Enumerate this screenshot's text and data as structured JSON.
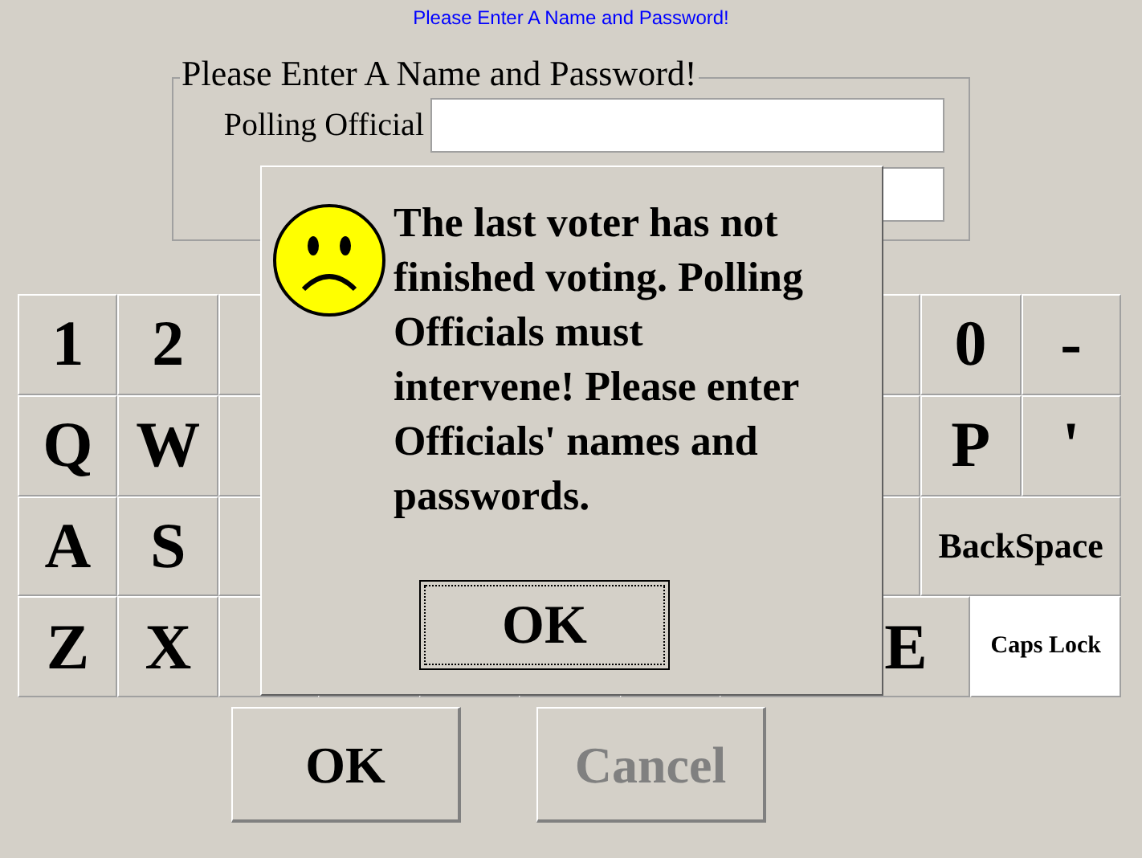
{
  "header": "Please Enter A Name and Password!",
  "login_group": {
    "title": "Please Enter A Name and Password!",
    "fields": [
      {
        "label": "Polling Official",
        "disabled": false
      },
      {
        "disabled": false
      }
    ]
  },
  "keyboard": {
    "rows": [
      [
        {
          "kind": "char",
          "label": "1"
        },
        {
          "kind": "char",
          "label": "2"
        },
        {
          "kind": "char"
        },
        {
          "kind": "covered"
        },
        {
          "kind": "covered"
        },
        {
          "kind": "covered"
        },
        {
          "kind": "covered"
        },
        {
          "kind": "covered"
        },
        {
          "kind": "char"
        },
        {
          "kind": "char",
          "label": "0"
        },
        {
          "kind": "char",
          "label": "-"
        }
      ],
      [
        {
          "kind": "char",
          "label": "Q"
        },
        {
          "kind": "char",
          "label": "W"
        },
        {
          "kind": "char"
        },
        {
          "kind": "covered"
        },
        {
          "kind": "covered"
        },
        {
          "kind": "covered"
        },
        {
          "kind": "covered"
        },
        {
          "kind": "covered"
        },
        {
          "kind": "char"
        },
        {
          "kind": "char",
          "label": "P"
        },
        {
          "kind": "char",
          "label": "'"
        }
      ],
      [
        {
          "kind": "char",
          "label": "A"
        },
        {
          "kind": "char",
          "label": "S"
        },
        {
          "kind": "char"
        },
        {
          "kind": "covered"
        },
        {
          "kind": "covered"
        },
        {
          "kind": "covered"
        },
        {
          "kind": "covered"
        },
        {
          "kind": "covered"
        },
        {
          "kind": "char"
        },
        {
          "kind": "backspace",
          "label": "BackSpace"
        }
      ],
      [
        {
          "kind": "char",
          "label": "Z"
        },
        {
          "kind": "char",
          "label": "X"
        },
        {
          "kind": "char"
        },
        {
          "kind": "char"
        },
        {
          "kind": "char"
        },
        {
          "kind": "char"
        },
        {
          "kind": "char"
        },
        {
          "kind": "space",
          "label": "E"
        },
        {
          "kind": "capslock",
          "label": "Caps Lock",
          "on": true
        }
      ]
    ]
  },
  "buttons": [
    {
      "label": "OK",
      "disabled": false
    },
    {
      "label": "Cancel",
      "disabled": true
    }
  ],
  "dialog": {
    "message": [
      "The last voter has not",
      "finished voting. Polling",
      "Officials must",
      "intervene! Please enter",
      "Officials' names and",
      "passwords."
    ],
    "button": "OK"
  }
}
